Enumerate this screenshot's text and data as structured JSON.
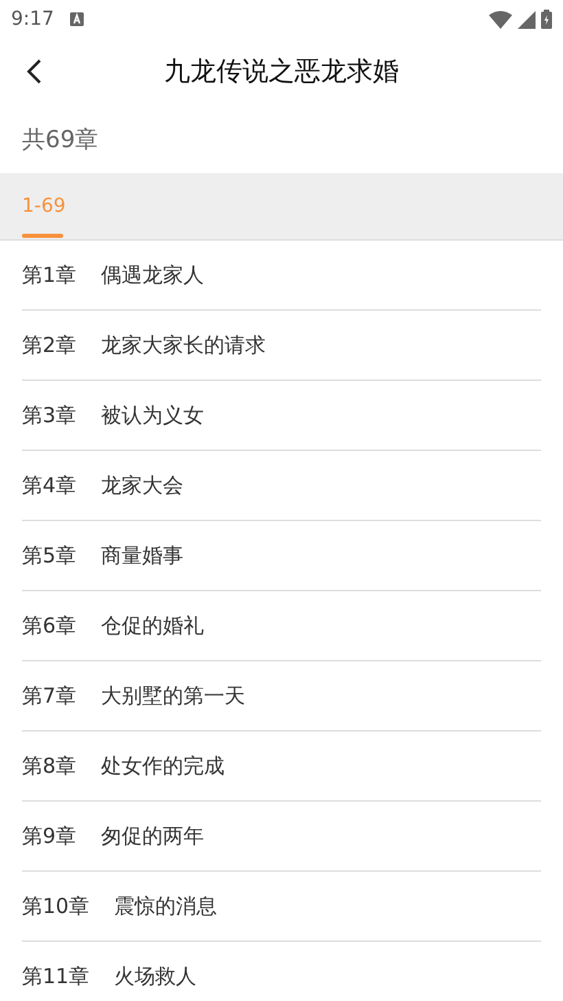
{
  "status_bar": {
    "time": "9:17"
  },
  "header": {
    "title": "九龙传说之恶龙求婚"
  },
  "chapter_count": "共69章",
  "tabs": [
    {
      "label": "1-69",
      "selected": true
    }
  ],
  "chapters": [
    {
      "number": "第1章",
      "title": "偶遇龙家人"
    },
    {
      "number": "第2章",
      "title": "龙家大家长的请求"
    },
    {
      "number": "第3章",
      "title": "被认为义女"
    },
    {
      "number": "第4章",
      "title": "龙家大会"
    },
    {
      "number": "第5章",
      "title": "商量婚事"
    },
    {
      "number": "第6章",
      "title": "仓促的婚礼"
    },
    {
      "number": "第7章",
      "title": "大别墅的第一天"
    },
    {
      "number": "第8章",
      "title": "处女作的完成"
    },
    {
      "number": "第9章",
      "title": "匆促的两年"
    },
    {
      "number": "第10章",
      "title": "震惊的消息"
    },
    {
      "number": "第11章",
      "title": "火场救人"
    }
  ]
}
